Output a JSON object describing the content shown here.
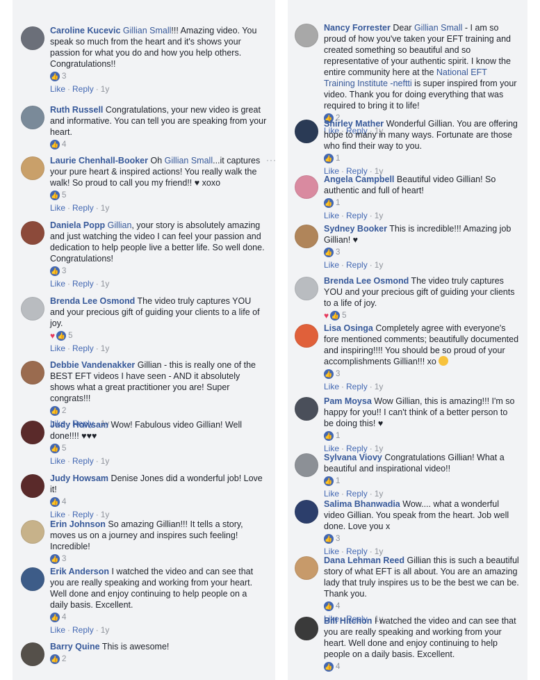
{
  "columns": {
    "left": [
      {
        "name": "Caroline Kucevic",
        "pre": "",
        "mention": "Gillian Small",
        "text": "!!! Amazing video. You speak so much from the heart and it's shows your passion for what you do and how you help others. Congratulations!!",
        "likes": "3",
        "hearts": 0,
        "like": "Like",
        "reply": "Reply",
        "time": "1y",
        "avatar": "#6b6f79"
      },
      {
        "name": "Ruth Russell",
        "pre": "",
        "mention": "",
        "text": "Congratulations, your new video is great and informative. You can tell you are speaking from your heart.",
        "likes": "4",
        "hearts": 0,
        "like": "",
        "reply": "",
        "time": "",
        "avatar": "#7a8a99"
      },
      {
        "name": "Laurie Chenhall-Booker",
        "pre": "Oh ",
        "mention": "Gillian Small",
        "text": "...it captures your pure heart & inspired actions! You really walk the walk! So proud to call you my friend!! ♥ xoxo",
        "likes": "5",
        "hearts": 0,
        "like": "Like",
        "reply": "Reply",
        "time": "1y",
        "avatar": "#c9a06a",
        "more": "···"
      },
      {
        "name": "Daniela Popp",
        "pre": "",
        "mention": "Gillian",
        "text": ", your story is absolutely amazing and just watching the video I can feel your passion and dedication to help people live a better life. So well done. Congratulations!",
        "likes": "3",
        "hearts": 0,
        "like": "Like",
        "reply": "Reply",
        "time": "1y",
        "avatar": "#8c4a3a"
      },
      {
        "name": "Brenda Lee Osmond",
        "pre": "",
        "mention": "",
        "text": "The video truly captures YOU and your precious gift of guiding your clients to a life of joy.",
        "likes": "5",
        "hearts": 1,
        "like": "Like",
        "reply": "Reply",
        "time": "1y",
        "avatar": "#b9bcc0"
      },
      {
        "name": "Debbie Vandenakker",
        "pre": "",
        "mention": "",
        "text": "Gillian - this is really one of the BEST EFT videos I have seen - AND it absolutely shows what a great practitioner you are! Super congrats!!!",
        "likes": "2",
        "hearts": 0,
        "like": "Like",
        "reply": "Reply",
        "time": "1y",
        "avatar": "#9a6b4f"
      },
      {
        "name": "Judy Howsam",
        "pre": "",
        "mention": "",
        "text": "Wow! Fabulous video Gillian! Well done!!!! ♥♥♥",
        "likes": "5",
        "hearts": 0,
        "like": "Like",
        "reply": "Reply",
        "time": "1y",
        "avatar": "#5a2a2a"
      },
      {
        "name": "Judy Howsam",
        "pre": "",
        "mention": "",
        "text": "Denise Jones did a wonderful job! Love it!",
        "likes": "4",
        "hearts": 0,
        "like": "Like",
        "reply": "Reply",
        "time": "1y",
        "avatar": "#5a2a2a"
      },
      {
        "name": "Erin Johnson",
        "pre": "",
        "mention": "",
        "text": "So amazing Gillian!!! It tells a story, moves us on a journey and inspires such feeling! Incredible!",
        "likes": "3",
        "hearts": 0,
        "like": "",
        "reply": "",
        "time": "",
        "avatar": "#c7b28a"
      },
      {
        "name": "Erik Anderson",
        "pre": "",
        "mention": "",
        "text": "I watched the video and can see that you are really speaking and working from your heart. Well done and enjoy continuing to help people on a daily basis. Excellent.",
        "likes": "4",
        "hearts": 0,
        "like": "Like",
        "reply": "Reply",
        "time": "1y",
        "avatar": "#3d5c88"
      },
      {
        "name": "Barry Quine",
        "pre": "",
        "mention": "",
        "text": "This is awesome!",
        "likes": "2",
        "hearts": 0,
        "like": "",
        "reply": "",
        "time": "",
        "avatar": "#55504a"
      }
    ],
    "right": [
      {
        "name": "Nancy Forrester",
        "pre": "Dear ",
        "mention": "Gillian Small",
        "text": " - I am so proud of how you've taken your EFT training and created something so beautiful and so representative of your authentic spirit. I know the entire community here at the ",
        "mention2": "National EFT Training Institute -neftti",
        "text2": " is super inspired from your video. Thank you for doing everything that was required to bring it to life!",
        "likes": "2",
        "hearts": 0,
        "like": "Like",
        "reply": "Reply",
        "time": "1y",
        "avatar": "#a8a8a8"
      },
      {
        "name": "Shirley Mather",
        "pre": "",
        "mention": "",
        "text": "Wonderful Gillian. You are offering hope to many in many ways. Fortunate are those who find their way to you.",
        "likes": "1",
        "hearts": 0,
        "like": "Like",
        "reply": "Reply",
        "time": "1y",
        "avatar": "#2a3a55"
      },
      {
        "name": "Angela Campbell",
        "pre": "",
        "mention": "",
        "text": "Beautiful video Gillian! So authentic and full of heart!",
        "likes": "1",
        "hearts": 0,
        "like": "Like",
        "reply": "Reply",
        "time": "1y",
        "avatar": "#d98aa0"
      },
      {
        "name": "Sydney Booker",
        "pre": "",
        "mention": "",
        "text": "This is incredible!!! Amazing job Gillian! ♥",
        "likes": "3",
        "hearts": 0,
        "like": "Like",
        "reply": "Reply",
        "time": "1y",
        "avatar": "#b0855a"
      },
      {
        "name": "Brenda Lee Osmond",
        "pre": "",
        "mention": "",
        "text": "The video truly captures YOU and your precious gift of guiding your clients to a life of joy.",
        "likes": "5",
        "hearts": 1,
        "like": "",
        "reply": "",
        "time": "",
        "avatar": "#b9bcc0"
      },
      {
        "name": "Lisa Osinga",
        "pre": "",
        "mention": "",
        "text": "Completely agree with everyone's fore mentioned comments; beautifully documented and inspiring!!!! You should be so proud of your accomplishments Gillian!!! xo",
        "likes": "3",
        "hearts": 0,
        "like": "Like",
        "reply": "Reply",
        "time": "1y",
        "avatar": "#e0603a",
        "emoji": true
      },
      {
        "name": "Pam Moysa",
        "pre": "",
        "mention": "",
        "text": "Wow Gillian, this is amazing!!! I'm so happy for you!! I can't think of a better person to be doing this! ♥",
        "likes": "1",
        "hearts": 0,
        "like": "Like",
        "reply": "Reply",
        "time": "1y",
        "avatar": "#4a4f5a"
      },
      {
        "name": "Sylvana Viovy",
        "pre": "",
        "mention": "",
        "text": "Congratulations Gillian! What a beautiful and inspirational video!!",
        "likes": "1",
        "hearts": 0,
        "like": "Like",
        "reply": "Reply",
        "time": "1y",
        "avatar": "#8c9096"
      },
      {
        "name": "Salima Bhanwadia",
        "pre": "",
        "mention": "",
        "text": "Wow.... what a wonderful video Gillian. You speak from the heart. Job well done. Love you x",
        "likes": "3",
        "hearts": 0,
        "like": "Like",
        "reply": "Reply",
        "time": "1y",
        "avatar": "#2c3e6b"
      },
      {
        "name": "Dana Lehman Reed",
        "pre": "",
        "mention": "",
        "text": "Gillian this is such a beautiful story of what EFT is all about. You are an amazing lady that truly inspires us to be the best we can be. Thank you.",
        "likes": "4",
        "hearts": 0,
        "like": "Like",
        "reply": "Reply",
        "time": "1y",
        "avatar": "#c79a6a"
      },
      {
        "name": "Bill Hitchon",
        "pre": "",
        "mention": "",
        "text": "I watched the video and can see that you are really speaking and working from your heart. Well done and enjoy continuing to help people on a daily basis. Excellent.",
        "likes": "4",
        "hearts": 0,
        "like": "",
        "reply": "",
        "time": "",
        "avatar": "#3a3a3a"
      }
    ]
  },
  "icons": {
    "like": "thumbs-up-icon",
    "heart": "heart-icon"
  },
  "colors": {
    "name": "#365899",
    "link": "#4267b2",
    "like_bg": "#4267b2",
    "heart": "#e5395c",
    "meta": "#90949c",
    "panel": "#f2f3f5"
  }
}
